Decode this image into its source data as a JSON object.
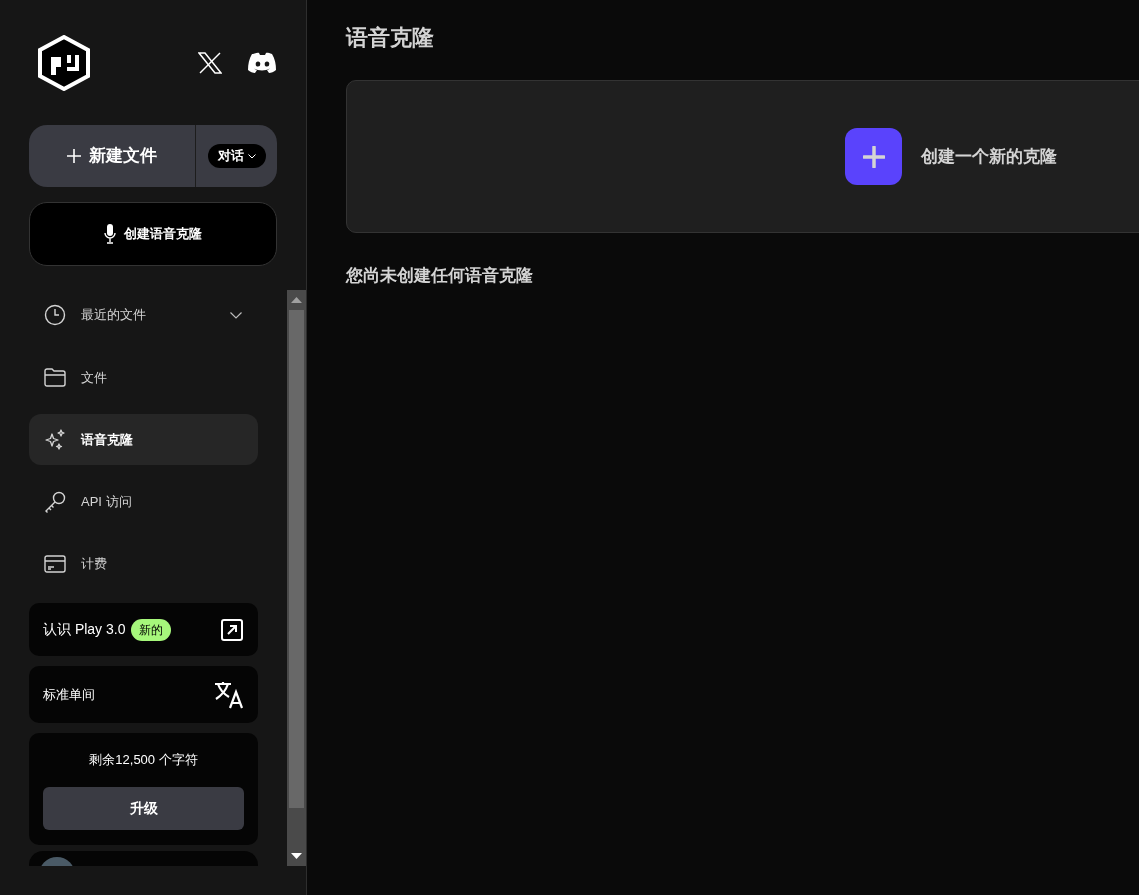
{
  "sidebar": {
    "new_file_button": "新建文件",
    "mode_dropdown": "对话",
    "voice_clone_button": "创建语音克隆",
    "recent_files": {
      "label": "最近的文件",
      "expanded": false
    },
    "nav_items": [
      {
        "label": "文件",
        "selected": false
      },
      {
        "label": "语音克隆",
        "selected": true
      },
      {
        "label": "API 访问",
        "selected": false
      },
      {
        "label": "计费",
        "selected": false
      }
    ],
    "promo": {
      "text": "认识 Play 3.0",
      "badge": "新的"
    },
    "language": {
      "label": "标准单间"
    },
    "quota": {
      "text": "剩余12,500 个字符",
      "button": "升级"
    }
  },
  "main": {
    "title": "语音克隆",
    "create_card": {
      "label": "创建一个新的克隆"
    },
    "empty_message": "您尚未创建任何语音克隆"
  }
}
